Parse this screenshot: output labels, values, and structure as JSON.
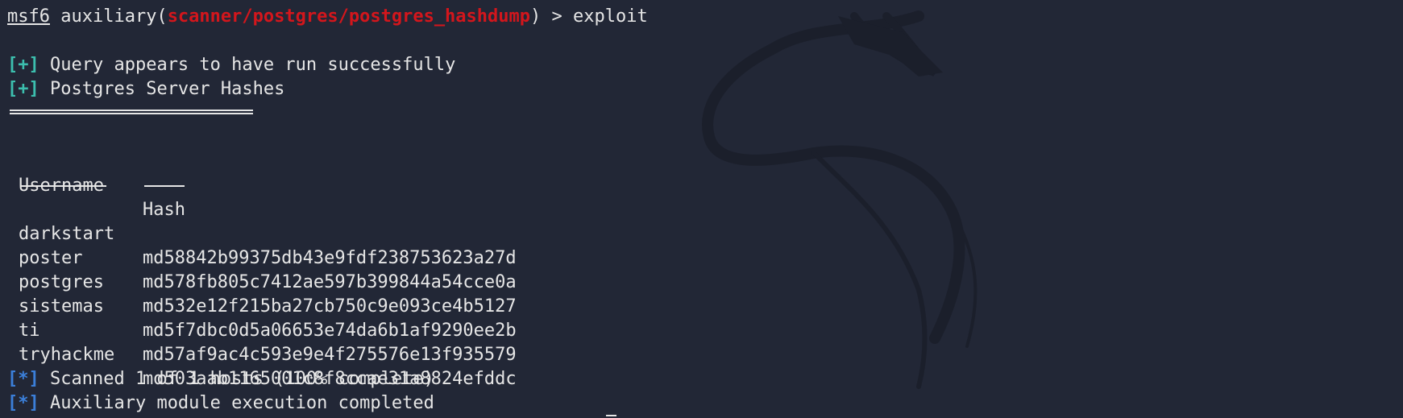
{
  "prompt": {
    "msf": "msf6",
    "pre": " auxiliary(",
    "module": "scanner/postgres/postgres_hashdump",
    "post": ") > exploit"
  },
  "messages": {
    "plus_tag": "[+]",
    "star_tag": "[*]",
    "query_ok": " Query appears to have run successfully",
    "hashes_title": " Postgres Server Hashes",
    "scanned": " Scanned 1 of 1 hosts (100% complete)",
    "completed": " Auxiliary module execution completed"
  },
  "table": {
    "headers": {
      "username": "Username",
      "hash": "Hash"
    },
    "rows": [
      {
        "username": "darkstart",
        "hash": "md58842b99375db43e9fdf238753623a27d"
      },
      {
        "username": "poster",
        "hash": "md578fb805c7412ae597b399844a54cce0a"
      },
      {
        "username": "postgres",
        "hash": "md532e12f215ba27cb750c9e093ce4b5127"
      },
      {
        "username": "sistemas",
        "hash": "md5f7dbc0d5a06653e74da6b1af9290ee2b"
      },
      {
        "username": "ti",
        "hash": "md57af9ac4c593e9e4f275576e13f935579"
      },
      {
        "username": "tryhackme",
        "hash": "md503aab1165001c8f8ccae31a8824efddc"
      }
    ]
  },
  "colors": {
    "background": "#222736",
    "text": "#e6e6e6",
    "module": "#d3161c",
    "plus": "#3cbfae",
    "star": "#3b7fd9"
  },
  "decor": {
    "background_icon": "kali-dragon-icon"
  }
}
